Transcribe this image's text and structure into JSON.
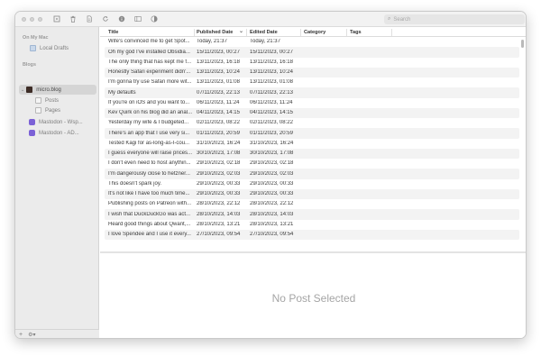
{
  "search": {
    "placeholder": "Search"
  },
  "toolbar": {
    "icons": [
      "new-post-icon",
      "trash-icon",
      "document-icon",
      "refresh-icon",
      "info-icon",
      "sidebar-toggle-icon",
      "preview-icon"
    ]
  },
  "sidebar": {
    "sections": [
      {
        "label": "On My Mac",
        "items": [
          {
            "label": "Local Drafts",
            "icon": "folder-icon"
          }
        ]
      },
      {
        "label": "Blogs",
        "items": [
          {
            "label": "micro.blog",
            "icon": "microblog-icon"
          },
          {
            "label": "Posts",
            "icon": "document-icon"
          },
          {
            "label": "Pages",
            "icon": "document-icon"
          },
          {
            "label": "Mastodon - Wsp...",
            "icon": "mastodon-icon"
          },
          {
            "label": "Mastodon - AD...",
            "icon": "mastodon-icon"
          }
        ]
      }
    ],
    "footer": {
      "add": "+",
      "settings": "⚙▾"
    }
  },
  "table": {
    "columns": [
      "Title",
      "Published Date",
      "Edited Date",
      "Category",
      "Tags"
    ],
    "sort_indicator": "⌄",
    "rows": [
      {
        "title": "Wife's convinced me to get Spot...",
        "published": "Today, 21:37",
        "edited": "Today, 21:37"
      },
      {
        "title": "Oh my god I've installed Obsidia...",
        "published": "15/11/2023, 00:27",
        "edited": "15/11/2023, 00:27"
      },
      {
        "title": "The only thing that has kept me f...",
        "published": "13/11/2023, 16:18",
        "edited": "13/11/2023, 16:18"
      },
      {
        "title": "Honestly Safari experiment didn'...",
        "published": "13/11/2023, 10:24",
        "edited": "13/11/2023, 10:24"
      },
      {
        "title": "I'm gonna try use Safari more wit...",
        "published": "13/11/2023, 01:08",
        "edited": "13/11/2023, 01:08"
      },
      {
        "title": "My defaults",
        "published": "07/11/2023, 22:13",
        "edited": "07/11/2023, 22:13"
      },
      {
        "title": "If you're on iOS and you want to...",
        "published": "06/11/2023, 11:24",
        "edited": "06/11/2023, 11:24"
      },
      {
        "title": "Kev Quirk on his blog did an anal...",
        "published": "04/11/2023, 14:15",
        "edited": "04/11/2023, 14:15"
      },
      {
        "title": "Yesterday my wife & I budgeted...",
        "published": "02/11/2023, 08:22",
        "edited": "02/11/2023, 08:22"
      },
      {
        "title": "There's an app that I use very si...",
        "published": "01/11/2023, 20:59",
        "edited": "01/11/2023, 20:59"
      },
      {
        "title": "Tested Kagi for as-long-as-I-cou...",
        "published": "31/10/2023, 16:24",
        "edited": "31/10/2023, 16:24"
      },
      {
        "title": "I guess everyone will raise prices...",
        "published": "30/10/2023, 17:08",
        "edited": "30/10/2023, 17:08"
      },
      {
        "title": "I don't even need to host anythin...",
        "published": "29/10/2023, 02:18",
        "edited": "29/10/2023, 02:18"
      },
      {
        "title": "I'm dangerously close to hetzner...",
        "published": "29/10/2023, 02:03",
        "edited": "29/10/2023, 02:03"
      },
      {
        "title": "This doesn't spark joy.",
        "published": "29/10/2023, 00:33",
        "edited": "29/10/2023, 00:33"
      },
      {
        "title": "It's not like I have too much time...",
        "published": "29/10/2023, 00:33",
        "edited": "29/10/2023, 00:33"
      },
      {
        "title": "Publishing posts on Patreon with...",
        "published": "28/10/2023, 22:12",
        "edited": "28/10/2023, 22:12"
      },
      {
        "title": "I wish that DuckDuckGo was act...",
        "published": "28/10/2023, 14:03",
        "edited": "28/10/2023, 14:03"
      },
      {
        "title": "Heard good things about Qwant,...",
        "published": "28/10/2023, 13:21",
        "edited": "28/10/2023, 13:21"
      },
      {
        "title": "I love Spendee and I use it every...",
        "published": "27/10/2023, 09:54",
        "edited": "27/10/2023, 09:54"
      }
    ]
  },
  "detail": {
    "empty_label": "No Post Selected"
  }
}
